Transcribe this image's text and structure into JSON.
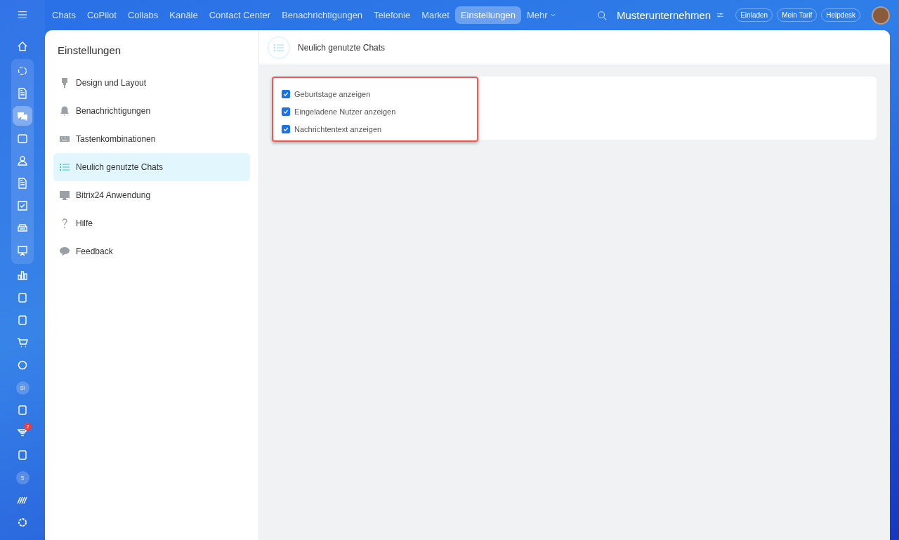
{
  "rail": {
    "top": [
      {
        "kind": "icon",
        "selected": false
      }
    ],
    "group": [
      {
        "kind": "icon",
        "selected": false
      },
      {
        "kind": "icon",
        "selected": false
      },
      {
        "kind": "icon",
        "selected": true
      },
      {
        "kind": "icon",
        "selected": false
      },
      {
        "kind": "icon",
        "selected": false
      },
      {
        "kind": "icon",
        "selected": false
      },
      {
        "kind": "icon",
        "selected": false
      },
      {
        "kind": "icon",
        "selected": false
      },
      {
        "kind": "icon",
        "selected": false
      }
    ],
    "bottom": [
      {
        "kind": "icon",
        "selected": false
      },
      {
        "kind": "icon",
        "selected": false
      },
      {
        "kind": "icon",
        "selected": false
      },
      {
        "kind": "icon",
        "selected": false
      },
      {
        "kind": "icon",
        "selected": false
      },
      {
        "kind": "avatar",
        "label": "SI",
        "selected": false
      },
      {
        "kind": "icon",
        "selected": false
      },
      {
        "kind": "icon",
        "selected": false,
        "badge": "2"
      },
      {
        "kind": "icon",
        "selected": false
      },
      {
        "kind": "avatar",
        "label": "S",
        "selected": false
      },
      {
        "kind": "icon",
        "selected": false
      },
      {
        "kind": "icon",
        "selected": false
      }
    ]
  },
  "nav": {
    "items": [
      {
        "label": "Chats",
        "selected": false
      },
      {
        "label": "CoPilot",
        "selected": false
      },
      {
        "label": "Collabs",
        "selected": false
      },
      {
        "label": "Kanäle",
        "selected": false
      },
      {
        "label": "Contact Center",
        "selected": false
      },
      {
        "label": "Benachrichtigungen",
        "selected": false
      },
      {
        "label": "Telefonie",
        "selected": false
      },
      {
        "label": "Market",
        "selected": false
      },
      {
        "label": "Einstellungen",
        "selected": true
      }
    ],
    "more": "Mehr",
    "company": "Musterunternehmen",
    "buttons": [
      "Einladen",
      "Mein Tarif",
      "Helpdesk"
    ]
  },
  "settings": {
    "title": "Einstellungen",
    "items": [
      {
        "label": "Design und Layout",
        "selected": false
      },
      {
        "label": "Benachrichtigungen",
        "selected": false
      },
      {
        "label": "Tastenkombinationen",
        "selected": false
      },
      {
        "label": "Neulich genutzte Chats",
        "selected": true
      },
      {
        "label": "Bitrix24 Anwendung",
        "selected": false
      },
      {
        "label": "Hilfe",
        "selected": false
      },
      {
        "label": "Feedback",
        "selected": false
      }
    ]
  },
  "section": {
    "title": "Neulich genutzte Chats",
    "options": [
      {
        "label": "Geburtstage anzeigen",
        "checked": true
      },
      {
        "label": "Eingeladene Nutzer anzeigen",
        "checked": true
      },
      {
        "label": "Nachrichtentext anzeigen",
        "checked": true
      }
    ]
  }
}
